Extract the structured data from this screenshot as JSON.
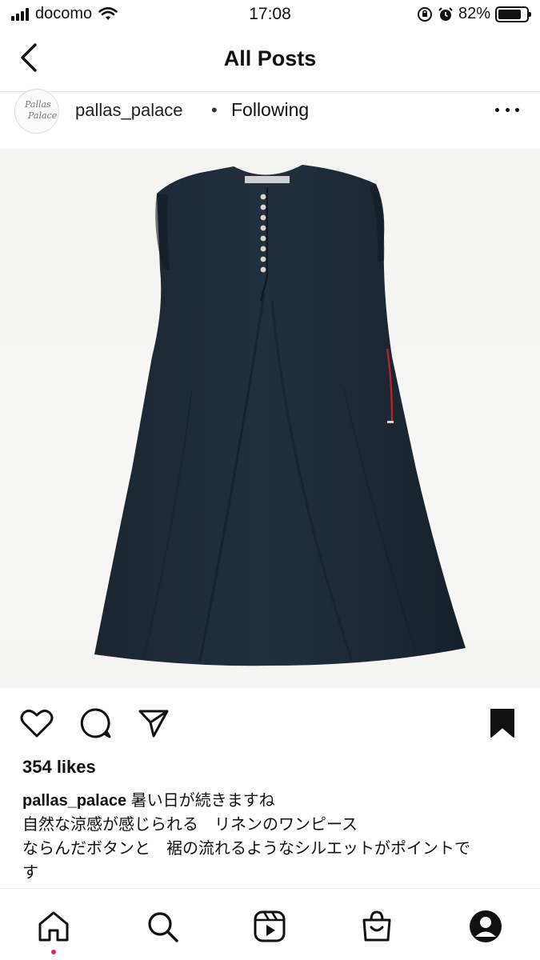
{
  "status_bar": {
    "carrier": "docomo",
    "time": "17:08",
    "battery_percent": "82%",
    "battery_level": 0.82,
    "icons": [
      "signal-icon",
      "wifi-icon",
      "orientation-lock-icon",
      "alarm-icon",
      "battery-icon"
    ]
  },
  "nav": {
    "title": "All Posts",
    "back_icon": "chevron-left-icon"
  },
  "post": {
    "username": "pallas_palace",
    "separator": "•",
    "follow_status": "Following",
    "avatar_text": "Pallas Palace",
    "more_icon": "more-horizontal-icon",
    "image_alt": "navy sleeveless linen dress with red lining and front buttons",
    "likes": "354 likes",
    "caption_user": "pallas_palace",
    "caption_lines": [
      "暑い日が続きますね",
      "自然な涼感が感じられる　リネンのワンピース",
      "ならんだボタンと　裾の流れるようなシルエットがポイントで",
      "す"
    ],
    "saved": true
  },
  "actions": {
    "like_icon": "heart-icon",
    "comment_icon": "comment-icon",
    "share_icon": "send-icon",
    "save_icon": "bookmark-icon"
  },
  "tabbar": {
    "items": [
      "home-icon",
      "search-icon",
      "reels-icon",
      "shop-icon",
      "profile-icon"
    ],
    "active": "home-icon",
    "notification_color": "#e0245e"
  },
  "colors": {
    "dress": "#1d2a36",
    "lining": "#b0252f",
    "background": "#f4f4f2"
  }
}
